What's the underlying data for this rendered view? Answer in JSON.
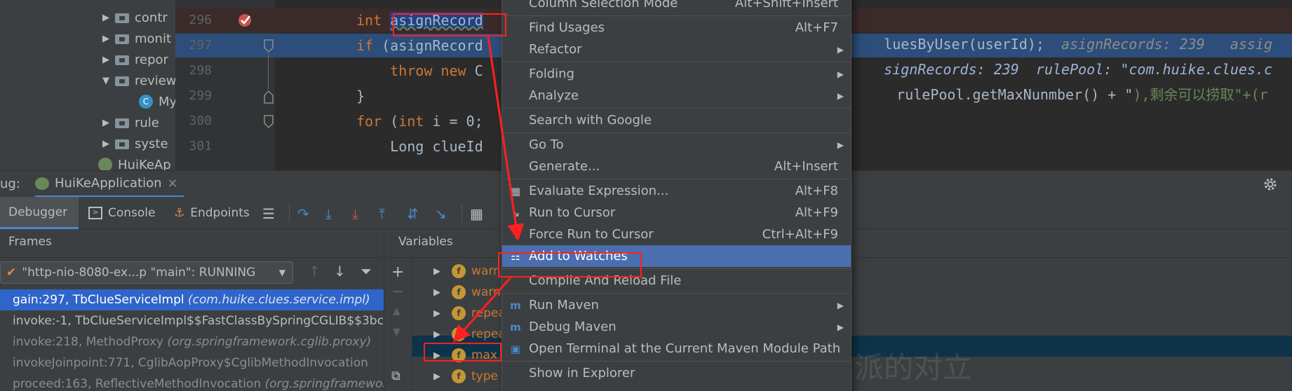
{
  "project_tree": {
    "items": [
      {
        "label": "contr",
        "type": "folder"
      },
      {
        "label": "monit",
        "type": "folder"
      },
      {
        "label": "repor",
        "type": "folder"
      },
      {
        "label": "review",
        "type": "folder",
        "expanded": true
      },
      {
        "label": "My",
        "type": "class"
      },
      {
        "label": "rule",
        "type": "folder"
      },
      {
        "label": "syste",
        "type": "folder"
      },
      {
        "label": "HuiKeAp",
        "type": "app"
      }
    ]
  },
  "editor": {
    "line_numbers": [
      "296",
      "297",
      "298",
      "299",
      "300",
      "301"
    ],
    "lines": [
      {
        "parts": [
          {
            "t": "int ",
            "c": "kw"
          },
          {
            "t": "asignRecord",
            "c": "hl"
          }
        ]
      },
      {
        "parts": [
          {
            "t": "if ",
            "c": "kw"
          },
          {
            "t": "(asignRecord",
            "c": "plain"
          }
        ]
      },
      {
        "parts": [
          {
            "t": "    throw new ",
            "c": "kw"
          },
          {
            "t": "C",
            "c": "plain"
          }
        ]
      },
      {
        "parts": [
          {
            "t": "}",
            "c": "plain"
          }
        ]
      },
      {
        "parts": [
          {
            "t": "for ",
            "c": "kw"
          },
          {
            "t": "(",
            "c": "plain"
          },
          {
            "t": "int ",
            "c": "kw"
          },
          {
            "t": "i = 0;",
            "c": "plain"
          }
        ]
      },
      {
        "parts": [
          {
            "t": "    Long clueId",
            "c": "plain"
          }
        ]
      }
    ],
    "right_text": {
      "line296_code": "luesByUser(userId);",
      "line296_inline": "asignRecords: 239   assig",
      "line297_inline": "signRecords: 239  rulePool: \"com.huike.clues.c",
      "line298_code_a": "rulePool.getMaxNunmber() + \"",
      "line298_code_b": "),剩余可以捞取\"+(r"
    }
  },
  "debug": {
    "label": "ug:",
    "run_config": "HuiKeApplication",
    "close_glyph": "×",
    "tabs": [
      "Debugger",
      "Console",
      "Endpoints"
    ],
    "frames_title": "Frames",
    "variables_title": "Variables",
    "thread": "\"http-nio-8080-ex...p \"main\": RUNNING",
    "frames": [
      {
        "method": "gain:297, TbClueServiceImpl ",
        "pkg": "(com.huike.clues.service.impl)"
      },
      {
        "method": "invoke:-1, TbClueServiceImpl$$FastClassBySpringCGLIB$$3bc",
        "pkg": ""
      },
      {
        "method": "invoke:218, MethodProxy ",
        "pkg": "(org.springframework.cglib.proxy)"
      },
      {
        "method": "invokeJoinpoint:771, CglibAopProxy$CglibMethodInvocation",
        "pkg": ""
      },
      {
        "method": "proceed:163, ReflectiveMethodInvocation ",
        "pkg": "(org.springframework"
      }
    ],
    "variables": [
      "warn",
      "warn",
      "repea",
      "repea",
      "max",
      "type"
    ]
  },
  "context_menu": {
    "items": [
      {
        "label": "Column Selection Mode",
        "shortcut": "Alt+Shift+Insert",
        "submenu": false,
        "icon": ""
      },
      {
        "label": "Find Usages",
        "shortcut": "Alt+F7",
        "submenu": false,
        "icon": ""
      },
      {
        "label": "Refactor",
        "shortcut": "",
        "submenu": true,
        "icon": ""
      },
      {
        "label": "Folding",
        "shortcut": "",
        "submenu": true,
        "icon": ""
      },
      {
        "label": "Analyze",
        "shortcut": "",
        "submenu": true,
        "icon": ""
      },
      {
        "label": "Search with Google",
        "shortcut": "",
        "submenu": false,
        "icon": ""
      },
      {
        "label": "Go To",
        "shortcut": "",
        "submenu": true,
        "icon": ""
      },
      {
        "label": "Generate...",
        "shortcut": "Alt+Insert",
        "submenu": false,
        "icon": ""
      },
      {
        "label": "Evaluate Expression...",
        "shortcut": "Alt+F8",
        "submenu": false,
        "icon": "calculator-icon"
      },
      {
        "label": "Run to Cursor",
        "shortcut": "Alt+F9",
        "submenu": false,
        "icon": "run-to-cursor-icon"
      },
      {
        "label": "Force Run to Cursor",
        "shortcut": "Ctrl+Alt+F9",
        "submenu": false,
        "icon": "force-run-icon"
      },
      {
        "label": "Add to Watches",
        "shortcut": "",
        "submenu": false,
        "icon": "watches-icon",
        "selected": true
      },
      {
        "label": "Compile And Reload File",
        "shortcut": "",
        "submenu": false,
        "icon": ""
      },
      {
        "label": "Run Maven",
        "shortcut": "",
        "submenu": true,
        "icon": "maven-icon"
      },
      {
        "label": "Debug Maven",
        "shortcut": "",
        "submenu": true,
        "icon": "maven-icon"
      },
      {
        "label": "Open Terminal at the Current Maven Module Path",
        "shortcut": "",
        "submenu": false,
        "icon": "maven-terminal-icon"
      },
      {
        "label": "Show in Explorer",
        "shortcut": "",
        "submenu": false,
        "icon": ""
      }
    ]
  },
  "watermark": "派的对立",
  "colors": {
    "selection": "#4b6eaf",
    "annotation": "#ff2020",
    "breakpoint": "#c75450",
    "keyword": "#cc7832"
  }
}
